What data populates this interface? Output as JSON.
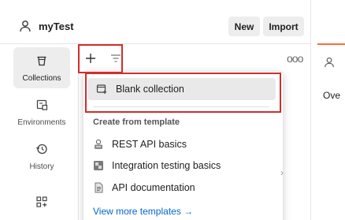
{
  "workspace": {
    "name": "myTest"
  },
  "header": {
    "new_label": "New",
    "import_label": "Import"
  },
  "sidebar": {
    "items": [
      {
        "label": "Collections",
        "icon": "trash-bin-icon",
        "active": true
      },
      {
        "label": "Environments",
        "icon": "environment-icon"
      },
      {
        "label": "History",
        "icon": "history-icon"
      },
      {
        "label": "",
        "icon": "add-apps-icon"
      }
    ]
  },
  "panel": {
    "more_label": "ooo"
  },
  "menu": {
    "blank_label": "Blank collection",
    "template_header": "Create from template",
    "templates": [
      {
        "label": "REST API basics",
        "icon": "rest-api-icon"
      },
      {
        "label": "Integration testing basics",
        "icon": "integration-icon"
      },
      {
        "label": "API documentation",
        "icon": "doc-icon"
      }
    ],
    "view_more": "View more templates →"
  },
  "right_panel": {
    "tab_label": "Ove"
  },
  "colors": {
    "accent": "#ff6c37",
    "highlight": "#d32c2c",
    "link": "#0265d2"
  }
}
